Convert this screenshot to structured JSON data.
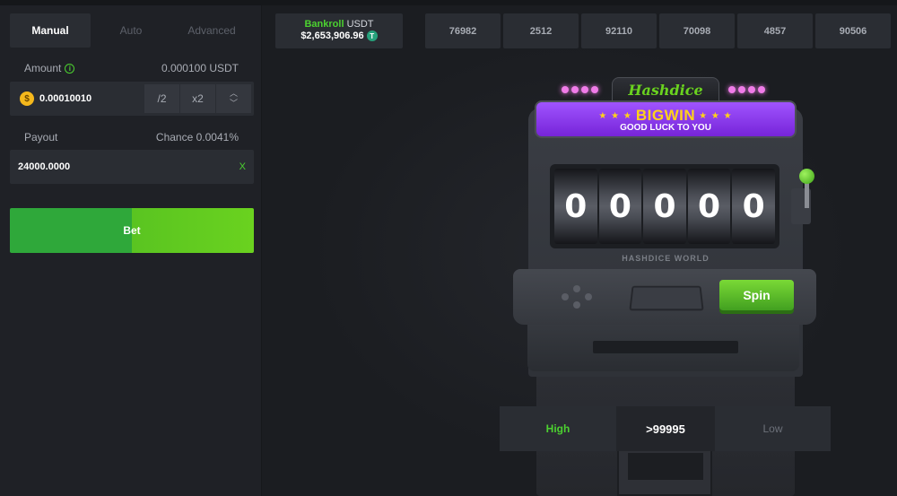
{
  "betting": {
    "tabs": [
      "Manual",
      "Auto",
      "Advanced"
    ],
    "active_tab": "Manual",
    "amount_label": "Amount",
    "amount_display": "0.000100 USDT",
    "amount_value": "0.00010010",
    "coin_symbol": "$",
    "half_label": "/2",
    "double_label": "x2",
    "payout_label": "Payout",
    "chance_label": "Chance",
    "chance_value": "0.0041%",
    "payout_value": "24000.0000",
    "payout_clear": "X",
    "bet_label": "Bet"
  },
  "bankroll": {
    "label": "Bankroll",
    "currency": "USDT",
    "value": "$2,653,906.96",
    "token_symbol": "T"
  },
  "history": [
    "76982",
    "2512",
    "92110",
    "70098",
    "4857",
    "90506"
  ],
  "machine": {
    "brand": "Hashdice",
    "banner_big": "BIGWIN",
    "banner_stars": "★ ★ ★",
    "banner_sub": "GOOD LUCK TO YOU",
    "reels": [
      "0",
      "0",
      "0",
      "0",
      "0"
    ],
    "world_label": "HASHDICE WORLD",
    "spin_label": "Spin"
  },
  "direction": {
    "high_label": "High",
    "target": ">99995",
    "low_label": "Low"
  },
  "colors": {
    "accent_green": "#4cd130",
    "panel": "#2a2d33",
    "banner_purple": "#8a3cf0",
    "banner_gold": "#ffd21a"
  }
}
